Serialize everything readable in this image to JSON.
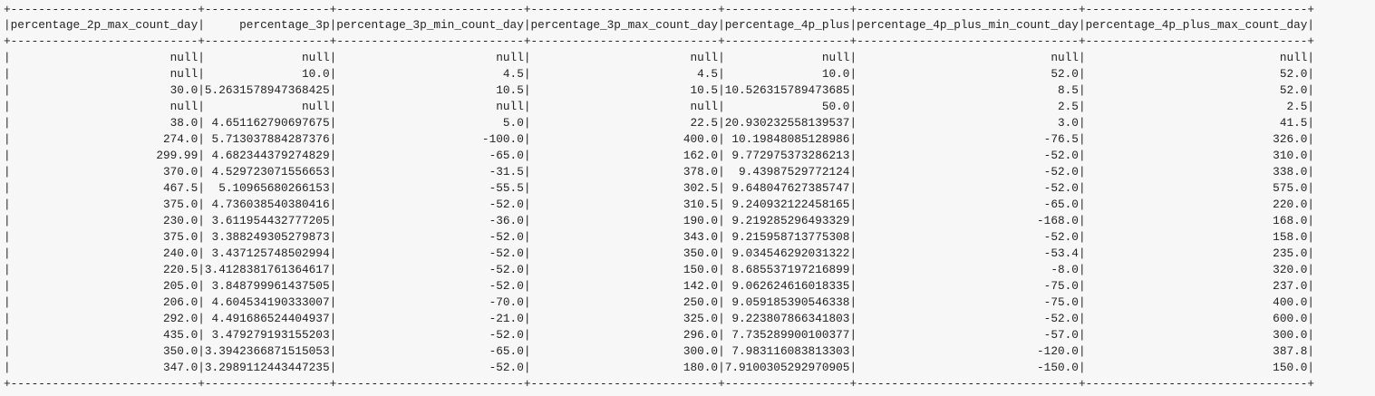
{
  "table": {
    "columns": [
      "percentage_2p_max_count_day",
      "percentage_3p",
      "percentage_3p_min_count_day",
      "percentage_3p_max_count_day",
      "percentage_4p_plus",
      "percentage_4p_plus_min_count_day",
      "percentage_4p_plus_max_count_day"
    ],
    "header_line": "|percentage_2p_max_count_day|     percentage_3p|percentage_3p_min_count_day|percentage_3p_max_count_day|percentage_4p_plus|percentage_4p_plus_min_count_day|percentage_4p_plus_max_count_day|",
    "separator_line": "+---------------------------+------------------+---------------------------+---------------------------+------------------+--------------------------------+--------------------------------+",
    "rows": [
      [
        "null",
        "null",
        "null",
        "null",
        "null",
        "null",
        "null"
      ],
      [
        "null",
        "10.0",
        "4.5",
        "4.5",
        "10.0",
        "52.0",
        "52.0"
      ],
      [
        "30.0",
        "5.2631578947368425",
        "10.5",
        "10.5",
        "10.526315789473685",
        "8.5",
        "52.0"
      ],
      [
        "null",
        "null",
        "null",
        "null",
        "50.0",
        "2.5",
        "2.5"
      ],
      [
        "38.0",
        "4.651162790697675",
        "5.0",
        "22.5",
        "20.930232558139537",
        "3.0",
        "41.5"
      ],
      [
        "274.0",
        "5.713037884287376",
        "-100.0",
        "400.0",
        "10.19848085128986",
        "-76.5",
        "326.0"
      ],
      [
        "299.99",
        "4.682344379274829",
        "-65.0",
        "162.0",
        "9.772975373286213",
        "-52.0",
        "310.0"
      ],
      [
        "370.0",
        "4.529723071556653",
        "-31.5",
        "378.0",
        "9.43987529772124",
        "-52.0",
        "338.0"
      ],
      [
        "467.5",
        "5.10965680266153",
        "-55.5",
        "302.5",
        "9.648047627385747",
        "-52.0",
        "575.0"
      ],
      [
        "375.0",
        "4.736038540380416",
        "-52.0",
        "310.5",
        "9.240932122458165",
        "-65.0",
        "220.0"
      ],
      [
        "230.0",
        "3.611954432777205",
        "-36.0",
        "190.0",
        "9.219285296493329",
        "-168.0",
        "168.0"
      ],
      [
        "375.0",
        "3.388249305279873",
        "-52.0",
        "343.0",
        "9.215958713775308",
        "-52.0",
        "158.0"
      ],
      [
        "240.0",
        "3.437125748502994",
        "-52.0",
        "350.0",
        "9.034546292031322",
        "-53.4",
        "235.0"
      ],
      [
        "220.5",
        "3.4128381761364617",
        "-52.0",
        "150.0",
        "8.685537197216899",
        "-8.0",
        "320.0"
      ],
      [
        "205.0",
        "3.848799961437505",
        "-52.0",
        "142.0",
        "9.062624616018335",
        "-75.0",
        "237.0"
      ],
      [
        "206.0",
        "4.604534190333007",
        "-70.0",
        "250.0",
        "9.059185390546338",
        "-75.0",
        "400.0"
      ],
      [
        "292.0",
        "4.491686524404937",
        "-21.0",
        "325.0",
        "9.223807866341803",
        "-52.0",
        "600.0"
      ],
      [
        "435.0",
        "3.479279193155203",
        "-52.0",
        "296.0",
        "7.735289900100377",
        "-57.0",
        "300.0"
      ],
      [
        "350.0",
        "3.3942366871515053",
        "-65.0",
        "300.0",
        "7.983116083813303",
        "-120.0",
        "387.8"
      ],
      [
        "347.0",
        "3.2989112443447235",
        "-52.0",
        "180.0",
        "7.9100305292970905",
        "-150.0",
        "150.0"
      ]
    ]
  }
}
